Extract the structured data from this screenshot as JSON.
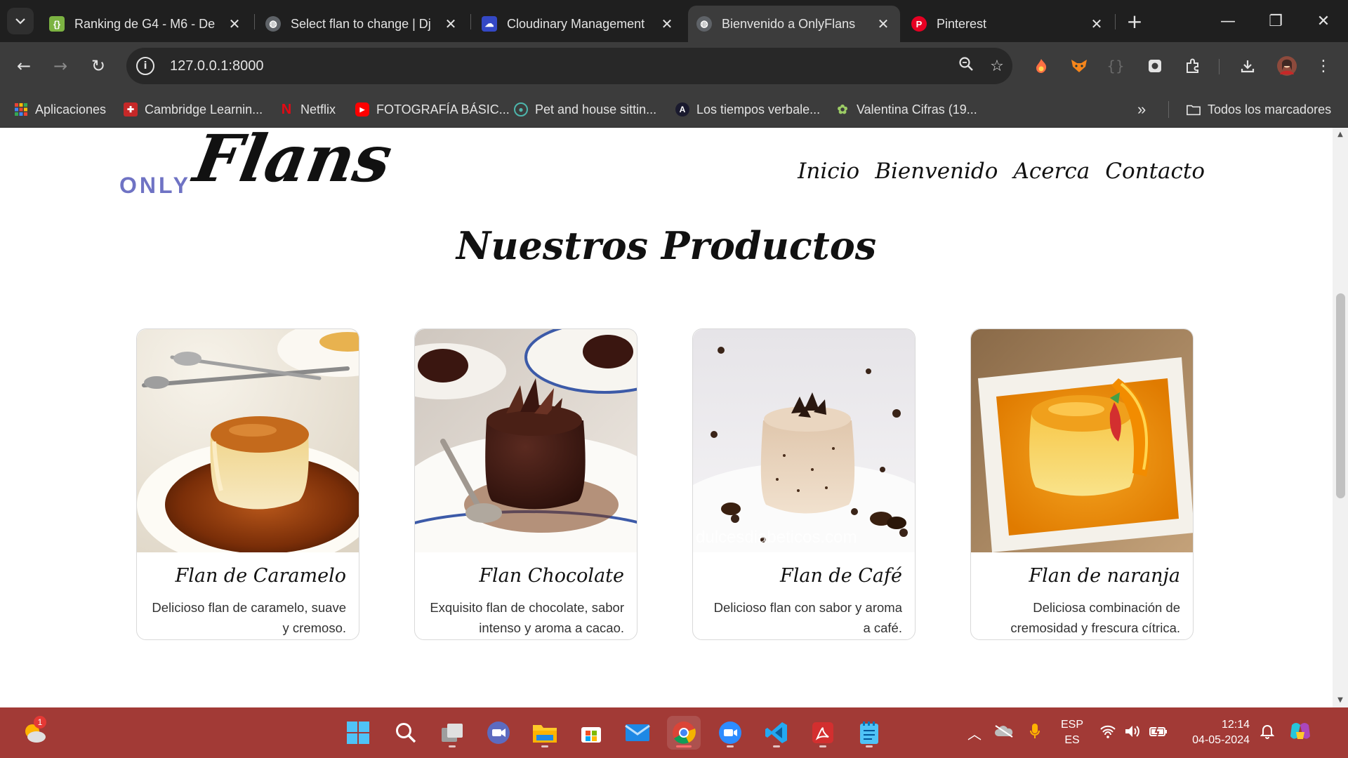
{
  "browser": {
    "tabs": [
      {
        "title": "Ranking de G4 - M6 - De",
        "favicon": "spreadsheet-icon",
        "color": "#7cb342",
        "active": false
      },
      {
        "title": "Select flan to change | Dj",
        "favicon": "globe-icon",
        "color": "#5f6368",
        "active": false
      },
      {
        "title": "Cloudinary Management",
        "favicon": "cloudinary-icon",
        "color": "#3448c5",
        "active": false
      },
      {
        "title": "Bienvenido a OnlyFlans",
        "favicon": "globe-icon",
        "color": "#5f6368",
        "active": true
      },
      {
        "title": "Pinterest",
        "favicon": "pinterest-icon",
        "color": "#e60023",
        "active": false
      }
    ],
    "url": "127.0.0.1:8000",
    "bookmarks": [
      {
        "label": "Aplicaciones",
        "icon": "apps-grid-icon"
      },
      {
        "label": "Cambridge Learnin...",
        "icon": "cambridge-icon"
      },
      {
        "label": "Netflix",
        "icon": "netflix-icon"
      },
      {
        "label": "FOTOGRAFÍA BÁSIC...",
        "icon": "youtube-icon"
      },
      {
        "label": "Pet and house sittin...",
        "icon": "paw-globe-icon"
      },
      {
        "label": "Los tiempos verbale...",
        "icon": "letter-a-icon"
      },
      {
        "label": "Valentina Cifras (19...",
        "icon": "leaf-icon"
      }
    ],
    "all_bookmarks": "Todos los marcadores"
  },
  "site": {
    "logo_small": "ONLY",
    "logo_big": "Flans",
    "nav": [
      "Inicio",
      "Bienvenido",
      "Acerca",
      "Contacto"
    ],
    "section_title": "Nuestros Productos",
    "products": [
      {
        "name": "Flan de Caramelo",
        "description": "Delicioso flan de caramelo, suave y cremoso.",
        "image": "caramel-flan-photo"
      },
      {
        "name": "Flan Chocolate",
        "description": "Exquisito flan de chocolate, sabor intenso y aroma a cacao.",
        "image": "chocolate-flan-photo"
      },
      {
        "name": "Flan de Café",
        "description": "Delicioso flan con sabor y aroma a café.",
        "image": "coffee-flan-photo",
        "watermark": "dulcesdiabeticos.com"
      },
      {
        "name": "Flan de naranja",
        "description": "Deliciosa combinación de cremosidad y frescura cítrica.",
        "image": "orange-flan-photo"
      }
    ]
  },
  "taskbar": {
    "notification_badge": "1",
    "language_top": "ESP",
    "language_bottom": "ES",
    "time": "12:14",
    "date": "04-05-2024"
  },
  "colors": {
    "taskbar": "#a23a36",
    "logo_accent": "#6f73c4",
    "chrome_dark": "#1f1f1f"
  }
}
